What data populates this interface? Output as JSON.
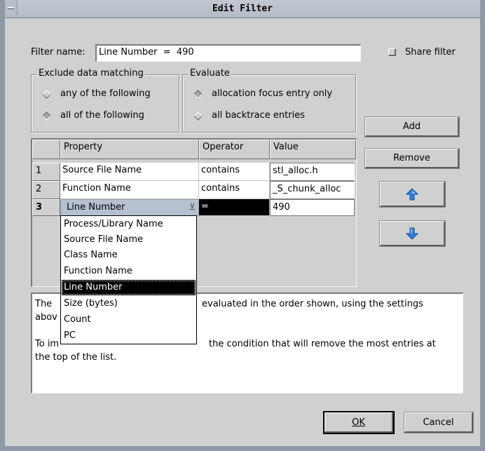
{
  "window": {
    "title": "Edit Filter"
  },
  "filter": {
    "name_label": "Filter name:",
    "name_value": "Line Number  =  490",
    "share_label": "Share filter"
  },
  "exclude": {
    "legend": "Exclude data matching",
    "options": [
      "any of the following",
      "all of the following"
    ],
    "selected_index": 1
  },
  "evaluate": {
    "legend": "Evaluate",
    "options": [
      "allocation focus entry only",
      "all backtrace entries"
    ],
    "selected_index": 0
  },
  "table": {
    "columns": [
      "Property",
      "Operator",
      "Value"
    ],
    "rows": [
      {
        "num": "1",
        "property": "Source File Name",
        "operator": "contains",
        "value": "stl_alloc.h"
      },
      {
        "num": "2",
        "property": "Function Name",
        "operator": "contains",
        "value": "_S_chunk_alloc"
      },
      {
        "num": "3",
        "property": "Line Number",
        "operator": "=",
        "value": "490"
      }
    ]
  },
  "dropdown": {
    "options": [
      "Process/Library Name",
      "Source File Name",
      "Class Name",
      "Function Name",
      "Line Number",
      "Size (bytes)",
      "Count",
      "PC"
    ],
    "selected_index": 4
  },
  "buttons": {
    "add": "Add",
    "remove": "Remove",
    "move_up_icon": "arrow-up-icon",
    "move_down_icon": "arrow-down-icon",
    "ok": "OK",
    "cancel": "Cancel"
  },
  "description": {
    "line1a": "The",
    "line1b": "evaluated in the order shown, using the settings",
    "line2a": "abov",
    "line3a": "To im",
    "line3b": "the condition that will remove the most entries at",
    "line4": "the top of the list."
  },
  "colors": {
    "accent_arrow": "#2d7fe0",
    "selection": "#000000"
  }
}
